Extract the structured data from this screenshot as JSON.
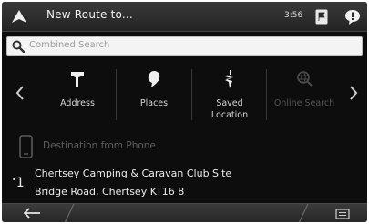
{
  "header": {
    "title": "New Route to...",
    "time": "3:56",
    "nav_icon": "navigation-arrow-icon",
    "flag_icon": "flag-icon",
    "messages_icon": "chat-bubble-icon"
  },
  "search": {
    "placeholder": "Combined Search",
    "icon": "search-icon"
  },
  "categories": {
    "items": [
      {
        "label": "Address",
        "icon": "address-pointer-icon",
        "enabled": true
      },
      {
        "label": "Places",
        "icon": "place-pin-icon",
        "enabled": true
      },
      {
        "label": "Saved\nLocation",
        "icon": "saved-location-pin-icon",
        "enabled": true
      },
      {
        "label": "Online Search",
        "icon": "online-search-icon",
        "enabled": false
      }
    ],
    "prev_icon": "chevron-left-icon",
    "next_icon": "chevron-right-icon"
  },
  "phone_destination": {
    "label": "Destination from Phone",
    "icon": "smartphone-icon",
    "enabled": false
  },
  "recent": {
    "index": "1",
    "line1": "Chertsey Camping & Caravan Club Site",
    "line2": "Bridge Road, Chertsey KT16 8"
  },
  "bottom_bar": {
    "back_icon": "back-arrow-icon",
    "menu_icon": "menu-icon"
  },
  "colors": {
    "background": "#0d0d0d",
    "bar": "#2e2e2e",
    "text": "#ececec",
    "disabled_text": "#5e5e5e"
  }
}
